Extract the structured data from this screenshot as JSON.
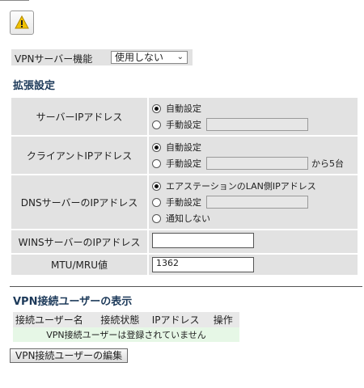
{
  "vpn_server": {
    "label": "VPNサーバー機能",
    "select_value": "使用しない"
  },
  "extended": {
    "title": "拡張設定",
    "server_ip": {
      "label": "サーバーIPアドレス",
      "opt_auto": "自動設定",
      "opt_manual": "手動設定",
      "manual_value": ""
    },
    "client_ip": {
      "label": "クライアントIPアドレス",
      "opt_auto": "自動設定",
      "opt_manual": "手動設定",
      "manual_value": "",
      "suffix": "から5台"
    },
    "dns": {
      "label": "DNSサーバーのIPアドレス",
      "opt_lan": "エアステーションのLAN側IPアドレス",
      "opt_manual": "手動設定",
      "opt_none": "通知しない",
      "manual_value": ""
    },
    "wins": {
      "label": "WINSサーバーのIPアドレス",
      "value": ""
    },
    "mtu": {
      "label": "MTU/MRU値",
      "value": "1362"
    }
  },
  "users": {
    "title": "VPN接続ユーザーの表示",
    "columns": [
      "接続ユーザー名",
      "接続状態",
      "IPアドレス",
      "操作"
    ],
    "empty_message": "VPN接続ユーザーは登録されていません",
    "edit_button": "VPN接続ユーザーの編集"
  },
  "icons": {
    "warning": "warning-triangle-icon"
  },
  "colors": {
    "accent_title": "#1d3a5a",
    "warning": "#f2c200",
    "row_bg": "#e2e2e2",
    "empty_row_bg": "#e6f7e6"
  }
}
